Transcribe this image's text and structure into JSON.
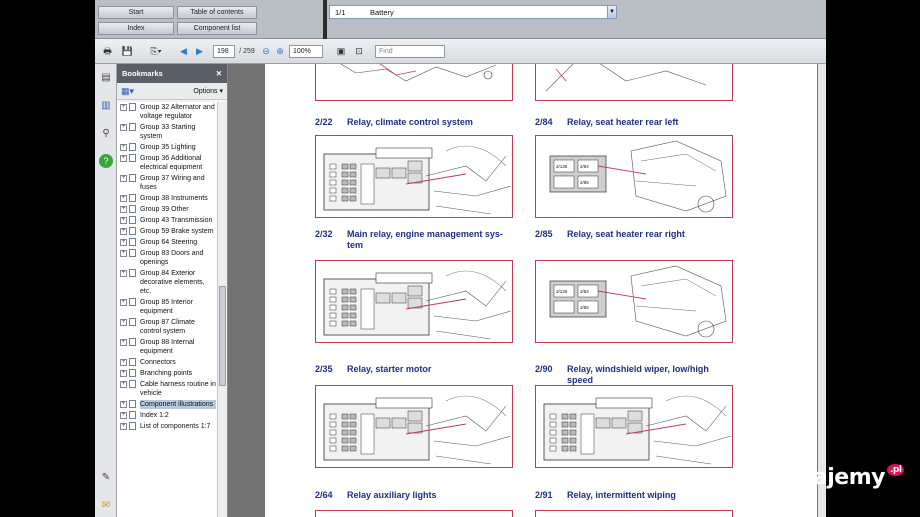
{
  "nav": {
    "start": "Start",
    "toc": "Table of contents",
    "index": "Index",
    "component_list": "Component list",
    "component_number": "1/1",
    "component_value": "Battery"
  },
  "toolbar": {
    "page_current": "198",
    "page_total": "/ 259",
    "zoom": "100%",
    "find_placeholder": "Find"
  },
  "bookmarks": {
    "title": "Bookmarks",
    "options": "Options",
    "items": [
      {
        "label": "Group 32 Alternator and voltage regulator",
        "selected": false
      },
      {
        "label": "Group 33 Starting system",
        "selected": false
      },
      {
        "label": "Group 35 Lighting",
        "selected": false
      },
      {
        "label": "Group 36 Additional electrical equipment",
        "selected": false
      },
      {
        "label": "Group 37 Wiring and fuses",
        "selected": false
      },
      {
        "label": "Group 38 Instruments",
        "selected": false
      },
      {
        "label": "Group 39 Other",
        "selected": false
      },
      {
        "label": "Group 43 Transmission",
        "selected": false
      },
      {
        "label": "Group 59 Brake system",
        "selected": false
      },
      {
        "label": "Group 64 Steering",
        "selected": false
      },
      {
        "label": "Group 83 Doors and openings",
        "selected": false
      },
      {
        "label": "Group 84 Exterior decorative elements, etc.",
        "selected": false
      },
      {
        "label": "Group 85 Interior equipment",
        "selected": false
      },
      {
        "label": "Group 87 Climate control system",
        "selected": false
      },
      {
        "label": "Group 88 Internal equipment",
        "selected": false
      },
      {
        "label": "Connectors",
        "selected": false
      },
      {
        "label": "Branching points",
        "selected": false
      },
      {
        "label": "Cable harness routine in vehicle",
        "selected": false
      },
      {
        "label": "Component illustrations",
        "selected": true
      },
      {
        "label": "Index 1:2",
        "selected": false
      },
      {
        "label": "List of components 1:7",
        "selected": false
      }
    ]
  },
  "diagrams": [
    {
      "num": "2/22",
      "title": "Relay, climate control system",
      "kind": "fusebox"
    },
    {
      "num": "2/84",
      "title": "Relay, seat heater rear left",
      "kind": "rear",
      "box_a": "2/135",
      "box_b": "2/84",
      "box_c": "2/85"
    },
    {
      "num": "2/32",
      "title": "Main relay, engine management sys-\ntem",
      "kind": "fusebox"
    },
    {
      "num": "2/85",
      "title": "Relay, seat heater rear right",
      "kind": "rear",
      "box_a": "2/136",
      "box_b": "2/84",
      "box_c": "2/85"
    },
    {
      "num": "2/35",
      "title": "Relay, starter motor",
      "kind": "fusebox"
    },
    {
      "num": "2/90",
      "title": "Relay, windshield wiper, low/high\nspeed",
      "kind": "fusebox"
    },
    {
      "num": "2/64",
      "title": "Relay auxiliary lights",
      "kind": "none"
    },
    {
      "num": "2/91",
      "title": "Relay, intermittent wiping",
      "kind": "none"
    }
  ],
  "watermark": {
    "text": "Sprzedajemy",
    "suffix": ".pl"
  },
  "colors": {
    "heading": "#1f2f83",
    "frame": "#c33a55",
    "selection": "#b7c9e1"
  }
}
